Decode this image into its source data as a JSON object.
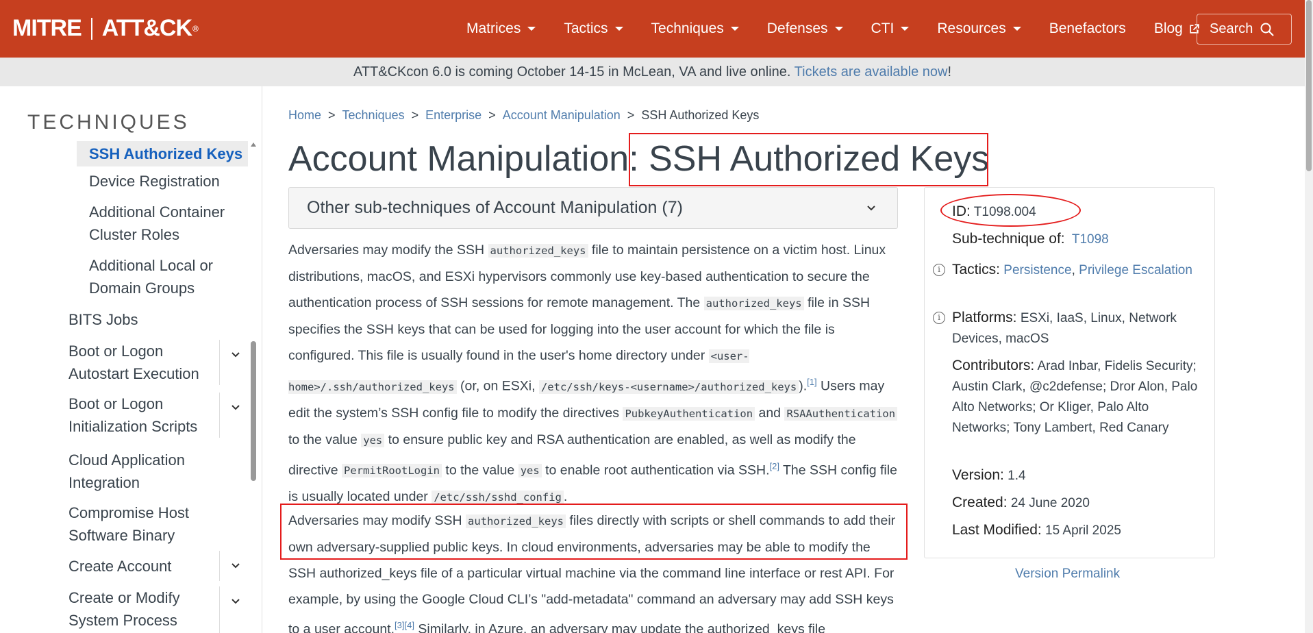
{
  "header": {
    "brand_left": "MITRE",
    "brand_right": "ATT&CK",
    "brand_mark": "®",
    "nav": [
      {
        "label": "Matrices",
        "dropdown": true
      },
      {
        "label": "Tactics",
        "dropdown": true
      },
      {
        "label": "Techniques",
        "dropdown": true
      },
      {
        "label": "Defenses",
        "dropdown": true
      },
      {
        "label": "CTI",
        "dropdown": true
      },
      {
        "label": "Resources",
        "dropdown": true
      },
      {
        "label": "Benefactors",
        "dropdown": false
      },
      {
        "label": "Blog",
        "dropdown": false,
        "external": true
      }
    ],
    "search_label": "Search",
    "accent": "#c63f1f"
  },
  "banner": {
    "text": "ATT&CKcon 6.0 is coming October 14-15 in McLean, VA and live online.",
    "link": "Tickets are available now",
    "suffix": "!"
  },
  "sidebar": {
    "title": "TECHNIQUES",
    "items": [
      {
        "label": "SSH Authorized Keys",
        "level": 2,
        "active": true
      },
      {
        "label": "Device Registration",
        "level": 2
      },
      {
        "label": "Additional Container Cluster Roles",
        "level": 2,
        "lines": [
          "Additional Container",
          "Cluster Roles"
        ]
      },
      {
        "label": "Additional Local or Domain Groups",
        "level": 2,
        "lines": [
          "Additional Local or",
          "Domain Groups"
        ]
      },
      {
        "label": "BITS Jobs",
        "level": 1
      },
      {
        "label": "Boot or Logon Autostart Execution",
        "level": 1,
        "expandable": true,
        "lines": [
          "Boot or Logon",
          "Autostart Execution"
        ]
      },
      {
        "label": "Boot or Logon Initialization Scripts",
        "level": 1,
        "expandable": true,
        "lines": [
          "Boot or Logon",
          "Initialization Scripts"
        ]
      },
      {
        "label": "Cloud Application Integration",
        "level": 1,
        "lines": [
          "Cloud Application",
          "Integration"
        ]
      },
      {
        "label": "Compromise Host Software Binary",
        "level": 1,
        "lines": [
          "Compromise Host",
          "Software Binary"
        ]
      },
      {
        "label": "Create Account",
        "level": 1,
        "expandable": true
      },
      {
        "label": "Create or Modify System Process",
        "level": 1,
        "expandable": true,
        "lines": [
          "Create or Modify",
          "System Process"
        ]
      }
    ]
  },
  "breadcrumb": {
    "items": [
      "Home",
      "Techniques",
      "Enterprise",
      "Account Manipulation"
    ],
    "current": "SSH Authorized Keys",
    "separator": ">"
  },
  "page": {
    "title_prefix": "Account Manipulation:",
    "title_main": "SSH Authorized Keys",
    "accordion_label": "Other sub-techniques of Account Manipulation (7)"
  },
  "description": {
    "p1": {
      "t1": "Adversaries may modify the SSH ",
      "c1": "authorized_keys",
      "t2": " file to maintain persistence on a victim host. Linux distributions, macOS, and ESXi hypervisors commonly use key-based authentication to secure the authentication process of SSH sessions for remote management. The ",
      "c2": "authorized_keys",
      "t3": " file in SSH specifies the SSH keys that can be used for logging into the user account for which the file is configured. This file is usually found in the user's home directory under ",
      "c3": "<user-home>/.ssh/authorized_keys",
      "t4": " (or, on ESXi, ",
      "c4": "/etc/ssh/keys-<username>/authorized_keys",
      "t5": ").",
      "r1": "[1]",
      "t6": " Users may edit the system’s SSH config file to modify the directives ",
      "c5": "PubkeyAuthentication",
      "t7": " and ",
      "c6": "RSAAuthentication",
      "t8": " to the value ",
      "c7": "yes",
      "t9": " to ensure public key and RSA authentication are enabled, as well as modify the directive ",
      "c8": "PermitRootLogin",
      "t10": " to the value ",
      "c9": "yes",
      "t11": " to enable root authentication via SSH.",
      "r2": "[2]",
      "t12": " The SSH config file is usually located under ",
      "c10": "/etc/ssh/sshd_config",
      "t13": "."
    },
    "p2": {
      "t1": "Adversaries may modify SSH ",
      "c1": "authorized_keys",
      "t2": " files directly with scripts or shell commands to add their own adversary-supplied public keys. In cloud environments, adversaries may be able to modify the SSH authorized_keys file of a particular virtual machine via the command line interface or rest API. For example, by using the Google Cloud CLI’s \"add-metadata\" command an adversary may add SSH keys to a user account.",
      "r1": "[3]",
      "r2": "[4]",
      "t3": " Similarly, in Azure, an adversary may update the authorized_keys file"
    }
  },
  "card": {
    "id_label": "ID:",
    "id_value": "T1098.004",
    "subof_label": "Sub-technique of:",
    "subof_value": "T1098",
    "tactics_label": "Tactics:",
    "tactics": [
      "Persistence",
      "Privilege Escalation"
    ],
    "platforms_label": "Platforms:",
    "platforms": "ESXi, IaaS, Linux, Network Devices, macOS",
    "contributors_label": "Contributors:",
    "contributors": "Arad Inbar, Fidelis Security; Austin Clark, @c2defense; Dror Alon, Palo Alto Networks; Or Kliger, Palo Alto Networks; Tony Lambert, Red Canary",
    "version_label": "Version:",
    "version": "1.4",
    "created_label": "Created:",
    "created": "24 June 2020",
    "modified_label": "Last Modified:",
    "modified": "15 April 2025",
    "permalink": "Version Permalink"
  }
}
